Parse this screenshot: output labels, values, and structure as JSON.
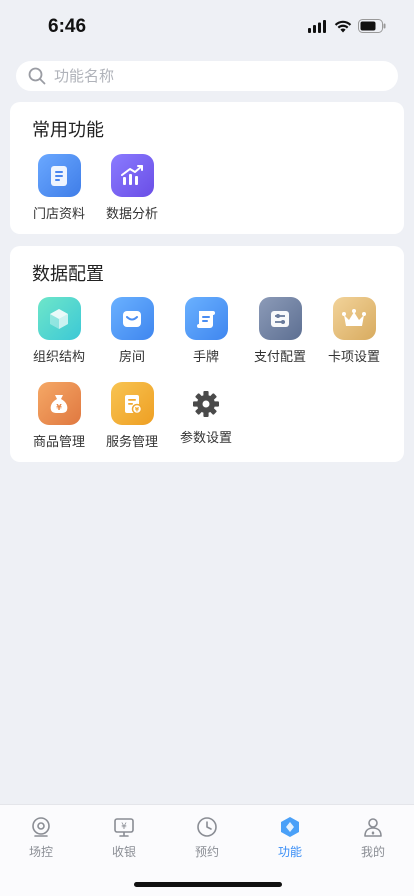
{
  "status": {
    "time": "6:46"
  },
  "search": {
    "placeholder": "功能名称"
  },
  "common": {
    "title": "常用功能",
    "items": [
      {
        "label": "门店资料",
        "icon": "document-icon"
      },
      {
        "label": "数据分析",
        "icon": "chart-trend-icon"
      }
    ]
  },
  "config": {
    "title": "数据配置",
    "items": [
      {
        "label": "组织结构",
        "icon": "cube-icon"
      },
      {
        "label": "房间",
        "icon": "sofa-icon"
      },
      {
        "label": "手牌",
        "icon": "scroll-tag-icon"
      },
      {
        "label": "支付配置",
        "icon": "sliders-icon"
      },
      {
        "label": "卡项设置",
        "icon": "crown-icon"
      },
      {
        "label": "商品管理",
        "icon": "money-bag-icon"
      },
      {
        "label": "服务管理",
        "icon": "service-doc-icon"
      },
      {
        "label": "参数设置",
        "icon": "gear-icon"
      }
    ]
  },
  "tabs": [
    {
      "label": "场控",
      "icon": "venue-icon",
      "active": false
    },
    {
      "label": "收银",
      "icon": "cashier-icon",
      "active": false
    },
    {
      "label": "预约",
      "icon": "clock-icon",
      "active": false
    },
    {
      "label": "功能",
      "icon": "function-icon",
      "active": true
    },
    {
      "label": "我的",
      "icon": "profile-icon",
      "active": false
    }
  ],
  "colors": {
    "accent": "#3a8ef6",
    "background": "#eef0f5",
    "tile_blue": "#4f8ff7",
    "tile_purple": "#7c62f0",
    "tile_teal": "#4fd6c8",
    "tile_slate": "#7688a8",
    "tile_gold": "#e9c27e",
    "tile_orange": "#f29a5a",
    "tile_amber": "#f5b43c"
  }
}
